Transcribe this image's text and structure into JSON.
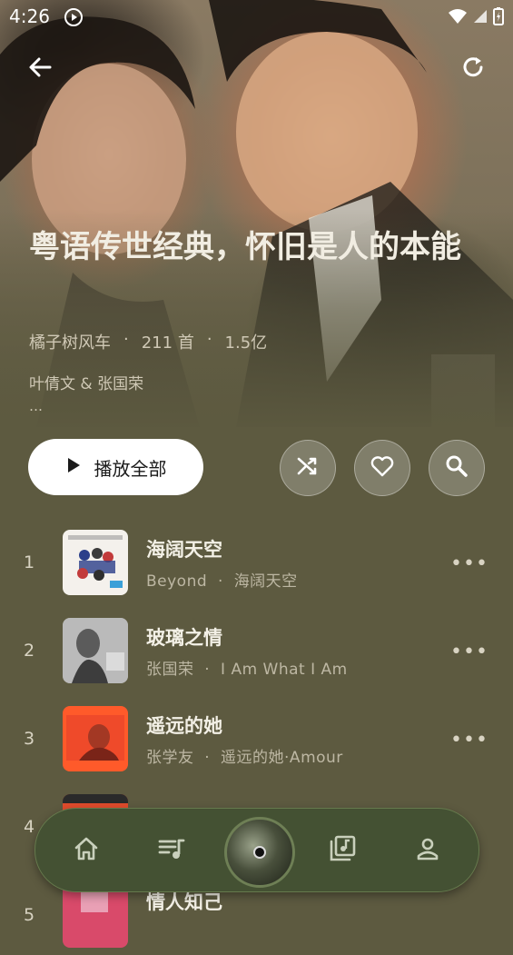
{
  "status_bar": {
    "time": "4:26"
  },
  "playlist": {
    "title": "粤语传世经典，怀旧是人的本能",
    "creator": "橘子树风车",
    "track_count": "211 首",
    "play_count": "1.5亿",
    "separator": "·",
    "artists": "叶倩文 & 张国荣",
    "more": "…"
  },
  "actions": {
    "play_all_label": "播放全部"
  },
  "tracks": [
    {
      "num": "1",
      "name": "海阔天空",
      "artist": "Beyond",
      "album": "海阔天空"
    },
    {
      "num": "2",
      "name": "玻璃之情",
      "artist": "张国荣",
      "album": "I Am What I Am"
    },
    {
      "num": "3",
      "name": "遥远的她",
      "artist": "张学友",
      "album": "遥远的她·Amour"
    },
    {
      "num": "4",
      "name": "",
      "artist": "",
      "album": ""
    },
    {
      "num": "5",
      "name": "情人知己",
      "artist": "",
      "album": ""
    }
  ],
  "colors": {
    "background": "#5d5a40",
    "nav_bar": "#445133"
  },
  "icons": {
    "back": "arrow-left",
    "refresh": "refresh",
    "shuffle": "shuffle",
    "favorite": "heart-outline",
    "search": "magnifier",
    "home": "home",
    "playlist": "queue-music",
    "library": "library-music",
    "profile": "person"
  }
}
